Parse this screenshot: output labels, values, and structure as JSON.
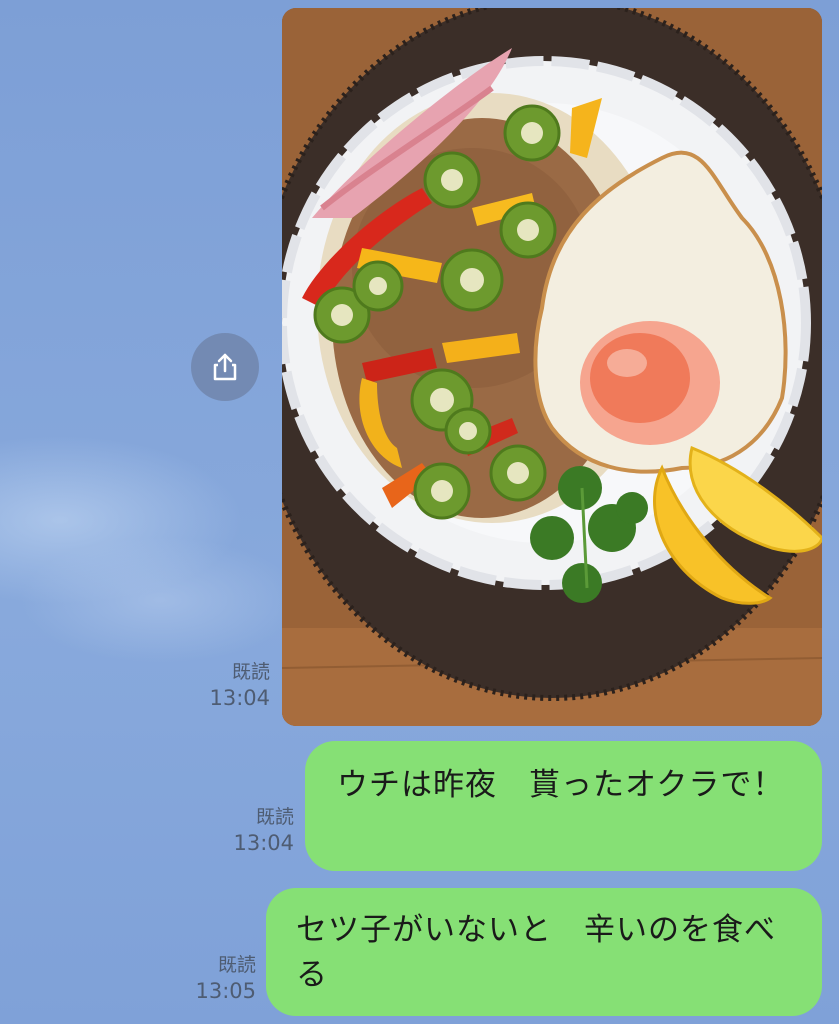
{
  "messages": [
    {
      "type": "image",
      "image_alt": "Photo of a rice plate with minced meat, okra, peppers, fried egg, cilantro and lemon",
      "read": "既読",
      "time": "13:04"
    },
    {
      "type": "text",
      "text": "ウチは昨夜　貰ったオクラで！",
      "read": "既読",
      "time": "13:04"
    },
    {
      "type": "text",
      "text": "セツ子がいないと　辛いのを食べる",
      "read": "既読",
      "time": "13:05"
    }
  ],
  "icons": {
    "share": "share-icon"
  },
  "colors": {
    "chat_background": "#7fa0d6",
    "sent_bubble": "#86e075",
    "meta_text": "#4e5c72"
  }
}
